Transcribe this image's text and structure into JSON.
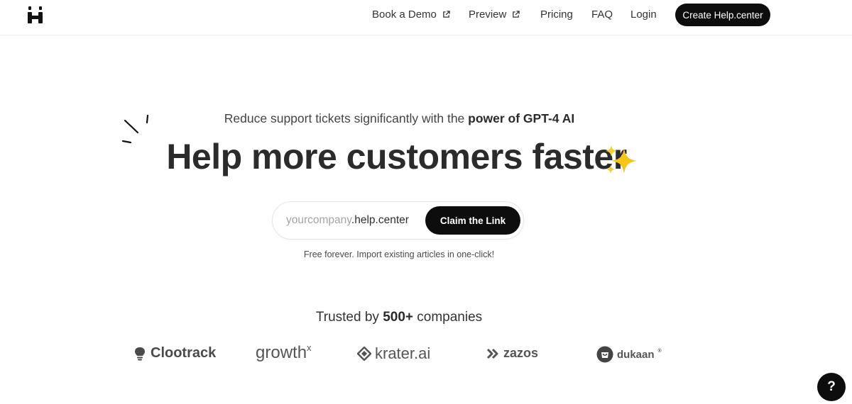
{
  "header": {
    "nav": [
      {
        "label": "Book a Demo",
        "external": true
      },
      {
        "label": "Preview",
        "external": true
      },
      {
        "label": "Pricing",
        "external": false
      },
      {
        "label": "FAQ",
        "external": false
      },
      {
        "label": "Login",
        "external": false
      }
    ],
    "cta_label": "Create Help.center"
  },
  "hero": {
    "subtitle_plain": "Reduce support tickets significantly with the ",
    "subtitle_bold": "power of GPT-4 AI",
    "headline": "Help more customers faster",
    "claim": {
      "placeholder": "yourcompany",
      "suffix": ".help.center",
      "button_label": "Claim the Link"
    },
    "note": "Free forever. Import existing articles in one-click!"
  },
  "trusted": {
    "prefix": "Trusted by ",
    "count": "500+",
    "suffix": " companies",
    "logos": {
      "clootrack": "Clootrack",
      "growthx_main": "growth",
      "growthx_sup": "x",
      "krater": "krater.ai",
      "zazos": "zazos",
      "dukaan": "dukaan",
      "dukaan_mark": "®"
    }
  },
  "help_fab": "?",
  "colors": {
    "primary": "#0d0d0d",
    "text": "#2b2b2b",
    "muted": "#a4a4a4",
    "sparkle": "#f5c518"
  },
  "icons": {
    "logo": "h-logo-icon",
    "external_link": "external-link-icon",
    "sparkle": "sparkles-icon",
    "help": "question-icon"
  }
}
